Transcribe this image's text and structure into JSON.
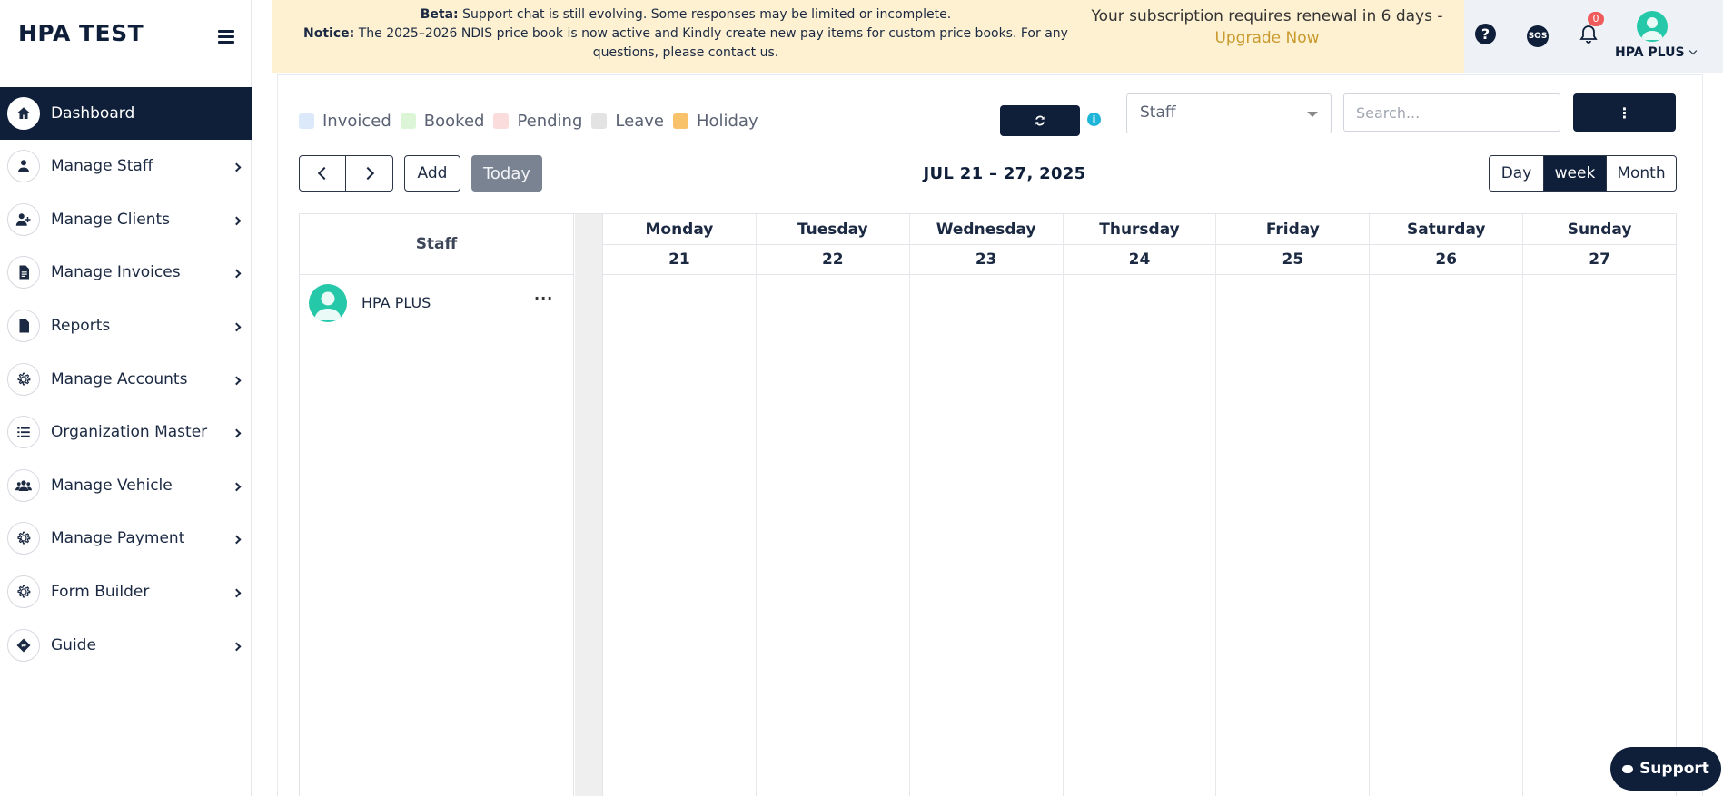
{
  "app": {
    "brand": "HPA TEST"
  },
  "sidebar": {
    "items": [
      {
        "label": "Dashboard",
        "icon": "home-icon",
        "active": true
      },
      {
        "label": "Manage Staff",
        "icon": "staff-icon"
      },
      {
        "label": "Manage Clients",
        "icon": "user-plus-icon"
      },
      {
        "label": "Manage Invoices",
        "icon": "invoice-icon"
      },
      {
        "label": "Reports",
        "icon": "file-icon"
      },
      {
        "label": "Manage Accounts",
        "icon": "gear-icon"
      },
      {
        "label": "Organization Master",
        "icon": "list-icon"
      },
      {
        "label": "Manage Vehicle",
        "icon": "users-icon"
      },
      {
        "label": "Manage Payment",
        "icon": "gear-icon"
      },
      {
        "label": "Form Builder",
        "icon": "gear-icon"
      },
      {
        "label": "Guide",
        "icon": "direction-icon"
      }
    ]
  },
  "notice": {
    "beta_label": "Beta:",
    "beta_text": " Support chat is still evolving. Some responses may be limited or incomplete.",
    "notice_label": "Notice:",
    "notice_text": " The 2025–2026 NDIS price book is now active and Kindly create new pay items for custom price books. For any questions, please contact us.",
    "subscription_text": "Your subscription requires renewal in 6 days -",
    "upgrade_link": "Upgrade Now"
  },
  "topbar": {
    "sos_label": "SOS",
    "notification_count": "0",
    "user_name": "HPA PLUS"
  },
  "legend": [
    {
      "label": "Invoiced",
      "color": "#dbe9fb"
    },
    {
      "label": "Booked",
      "color": "#dcf5d6"
    },
    {
      "label": "Pending",
      "color": "#fadcdc"
    },
    {
      "label": "Leave",
      "color": "#e3e3e3"
    },
    {
      "label": "Holiday",
      "color": "#f8c26a"
    }
  ],
  "filters": {
    "staff_select": "Staff",
    "search_placeholder": "Search..."
  },
  "toolbar": {
    "add_label": "Add",
    "today_label": "Today",
    "range_title": "JUL 21 – 27, 2025",
    "views": {
      "day": "Day",
      "week": "week",
      "month": "Month"
    },
    "active_view": "week"
  },
  "calendar": {
    "staff_header": "Staff",
    "days": [
      {
        "name": "Monday",
        "date": "21"
      },
      {
        "name": "Tuesday",
        "date": "22"
      },
      {
        "name": "Wednesday",
        "date": "23"
      },
      {
        "name": "Thursday",
        "date": "24"
      },
      {
        "name": "Friday",
        "date": "25"
      },
      {
        "name": "Saturday",
        "date": "26"
      },
      {
        "name": "Sunday",
        "date": "27"
      }
    ],
    "staff": [
      {
        "name": "HPA PLUS"
      }
    ]
  },
  "support": {
    "label": "Support"
  },
  "colors": {
    "primary": "#0f1f3a",
    "notice_bg": "#fdf1d2",
    "accent": "#c99a2e",
    "avatar": "#25c8a8"
  }
}
